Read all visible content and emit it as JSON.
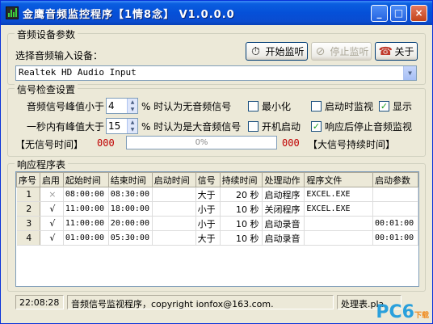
{
  "window": {
    "title": "金鹰音频监控程序【1情8念】 V1.0.0.0"
  },
  "title_buttons": {
    "minimize": "_",
    "maximize": "□",
    "close": "×"
  },
  "device_group": {
    "title": "音频设备参数",
    "select_label": "选择音频输入设备：",
    "device_value": "Realtek HD Audio Input",
    "start_button": "开始监听",
    "stop_button": "停止监听",
    "about_button": "关于"
  },
  "signal_group": {
    "title": "信号检查设置",
    "peak_label": "音频信号峰值小于",
    "peak_value": "4",
    "peak_suffix": "% 时认为无音频信号",
    "count_label": "一秒内有峰值大于",
    "count_value": "15",
    "count_suffix": "% 时认为是大音频信号",
    "checkboxes": [
      {
        "label": "最小化",
        "checked": false
      },
      {
        "label": "启动时监视",
        "checked": false
      },
      {
        "label": "显示",
        "checked": true
      },
      {
        "label": "开机启动",
        "checked": false
      },
      {
        "label": "响应后停止音频监视",
        "checked": true
      }
    ],
    "no_signal_label": "【无信号时间】",
    "no_signal_value": "000",
    "progress_value": 0,
    "progress_text": "0%",
    "big_signal_value": "000",
    "big_signal_label": "【大信号持续时间】"
  },
  "response_group": {
    "title": "响应程序表",
    "columns": [
      "序号",
      "启用",
      "起始时间",
      "结束时间",
      "启动时间",
      "信号",
      "持续时间",
      "处理动作",
      "程序文件",
      "启动参数"
    ],
    "rows": [
      {
        "index": "1",
        "enabled": "×",
        "start": "08:00:00",
        "end": "08:30:00",
        "launch": "",
        "signal": "大于",
        "duration": "20 秒",
        "action": "启动程序",
        "file": "EXCEL.EXE",
        "param": ""
      },
      {
        "index": "2",
        "enabled": "√",
        "start": "11:00:00",
        "end": "18:00:00",
        "launch": "",
        "signal": "小于",
        "duration": "10 秒",
        "action": "关闭程序",
        "file": "EXCEL.EXE",
        "param": ""
      },
      {
        "index": "3",
        "enabled": "√",
        "start": "11:00:00",
        "end": "20:00:00",
        "launch": "",
        "signal": "小于",
        "duration": "10 秒",
        "action": "启动录音",
        "file": "",
        "param": "00:01:00"
      },
      {
        "index": "4",
        "enabled": "√",
        "start": "01:00:00",
        "end": "05:30:00",
        "launch": "",
        "signal": "大于",
        "duration": "10 秒",
        "action": "启动录音",
        "file": "",
        "param": "00:01:00"
      }
    ]
  },
  "status_bar": {
    "time": "22:08:28",
    "message": "音频信号监视程序，copyright ionfox@163.com.",
    "file": "处理表.pla"
  },
  "watermark": {
    "main": "PC6",
    "sub": "下载"
  },
  "colors": {
    "titlebar": "#0550d8",
    "window_bg": "#ece9d8",
    "counter_red": "#c00000"
  }
}
